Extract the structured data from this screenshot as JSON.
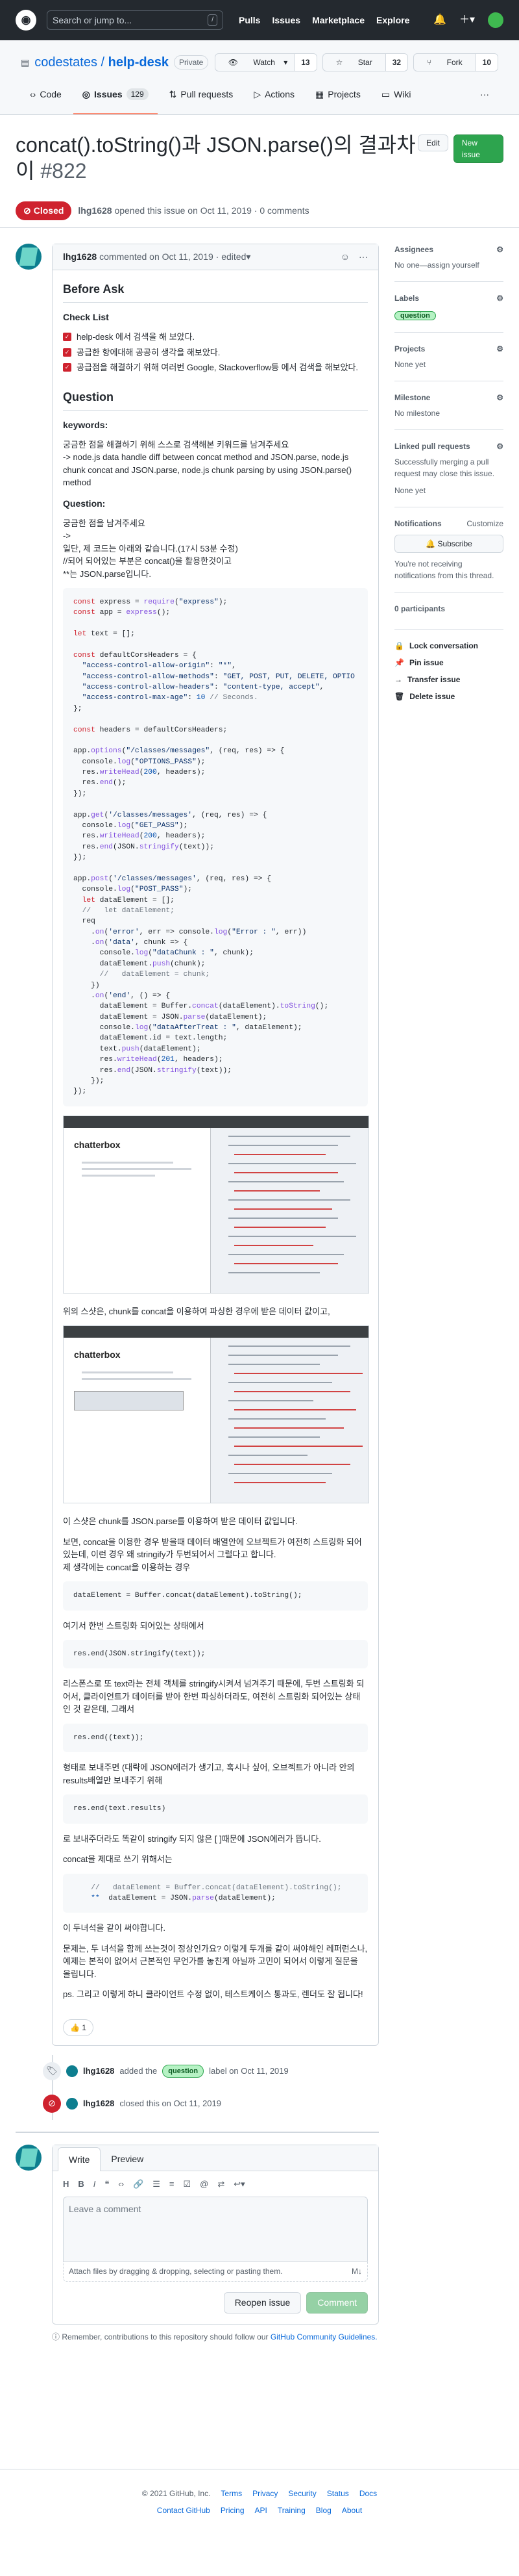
{
  "header": {
    "search_placeholder": "Search or jump to...",
    "search_key": "/",
    "nav": [
      "Pulls",
      "Issues",
      "Marketplace",
      "Explore"
    ]
  },
  "repo": {
    "owner": "codestates",
    "name": "help-desk",
    "visibility": "Private",
    "watch_label": "Watch",
    "watch_count": "13",
    "star_label": "Star",
    "star_count": "32",
    "fork_label": "Fork",
    "fork_count": "10"
  },
  "tabs": [
    {
      "label": "Code"
    },
    {
      "label": "Issues",
      "count": "129"
    },
    {
      "label": "Pull requests"
    },
    {
      "label": "Actions"
    },
    {
      "label": "Projects"
    },
    {
      "label": "Wiki"
    }
  ],
  "issue": {
    "title": "concat().toString()과 JSON.parse()의 결과차이",
    "number": "#822",
    "edit_label": "Edit",
    "new_label": "New issue",
    "state": "Closed",
    "author": "lhg1628",
    "opened_text": "opened this issue on Oct 11, 2019 · 0 comments"
  },
  "comment": {
    "author": "lhg1628",
    "meta": "commented on Oct 11, 2019 · edited",
    "h_before": "Before Ask",
    "h_checklist": "Check List",
    "checks": [
      "help-desk 에서 검색을 해 보았다.",
      "공급한 항에대해 공공히 생각을 해보았다.",
      "공급점을 해결하기 위해 여러번 Google, Stackoverflow등 에서 검색을 해보았다."
    ],
    "h_question": "Question",
    "h_keywords": "keywords:",
    "kw_p": "궁금한 점을 해결하기 위해 스스로 검색해본 키워드를 남겨주세요\n-> node.js data handle diff between concat method and JSON.parse, node.js chunk concat and JSON.parse, node.js chunk parsing by using JSON.parse() method",
    "h_q2": "Question:",
    "q_p": "궁금한 점을 남겨주세요\n->\n일단, 제 코드는 아래와 같습니다.(17시 53분 수정)\n//되어 되어있는 부분은 concat()을 활용한것이고\n**는 JSON.parse입니다.",
    "shot_title": "chatterbox",
    "after1": "위의 스샷은, chunk를 concat을 이용하여 파싱한 경우에 받은 데이터 값이고,",
    "after2": "이 스샷은 chunk를 JSON.parse를 이용하여 받은 데이터 값입니다.",
    "after3": "보면, concat을 이용한 경우 받을때 데이터 배열안에 오브젝트가 여전히 스트링화 되어있는데, 이런 경우 왜 stringify가 두번되어서 그럴다고 합니다.\n제 생각에는 concat을 이용하는 경우",
    "code3": "dataElement = Buffer.concat(dataElement).toString();",
    "after4": "여기서 한번 스트링화 되어있는 상태에서",
    "code4": "res.end(JSON.stringify(text));",
    "after5": "리스폰스로 또 text라는 전체 객체를 stringify시켜서 넘겨주기 때문에, 두번 스트링화 되어서, 클라이언트가 데이터를 받아 한번 파싱하더라도, 여전히 스트링화 되어있는 상태인 것 같은데, 그래서",
    "code5": "res.end((text));",
    "after6": "형태로 보내주면 (대략에 JSON에러가 생기고, 혹시나 싶어, 오브젝트가 아니라 안의 results배열만 보내주기 위해",
    "code6": "res.end(text.results)",
    "after7": "로 보내주더라도 똑같이 stringify 되지 않은 [ ]때문에 JSON에러가 뜹니다.",
    "after8": "concat을 제대로 쓰기 위해서는",
    "after9": "이 두녀석을 같이 써야합니다.",
    "after10": "문제는, 두 녀석을 함께 쓰는것이 정상인가요? 이렇게 두개를 같이 써야해인 레퍼런스나, 예제는 본적이 없어서 근본적인 무언가를 놓친게 아닐까 고민이 되어서 이렇게 질문을 올립니다.",
    "after11": "ps. 그리고 이렇게 하니 클라이언트 수정 없이, 테스트케이스 통과도, 렌더도 잘 됩니다!",
    "react": "👍 1"
  },
  "events": {
    "added_user": "lhg1628",
    "added_text": "added the",
    "label": "question",
    "added_suffix": "label on Oct 11, 2019",
    "closed_user": "lhg1628",
    "closed_text": "closed this on Oct 11, 2019"
  },
  "composer": {
    "tab_write": "Write",
    "tab_preview": "Preview",
    "placeholder": "Leave a comment",
    "attach": "Attach files by dragging & dropping, selecting or pasting them.",
    "reopen": "Reopen issue",
    "submit": "Comment",
    "remember": "Remember, contributions to this repository should follow our",
    "remember_link": "GitHub Community Guidelines."
  },
  "sidebar": {
    "assignees_h": "Assignees",
    "assignees_v": "No one—assign yourself",
    "labels_h": "Labels",
    "labels_v": "question",
    "projects_h": "Projects",
    "projects_v": "None yet",
    "milestone_h": "Milestone",
    "milestone_v": "No milestone",
    "linked_h": "Linked pull requests",
    "linked_v": "Successfully merging a pull request may close this issue.",
    "linked_none": "None yet",
    "notif_h": "Notifications",
    "notif_c": "Customize",
    "subscribe": "Subscribe",
    "notif_v": "You're not receiving notifications from this thread.",
    "participants": "0 participants",
    "actions": [
      "Lock conversation",
      "Pin issue",
      "Transfer issue",
      "Delete issue"
    ]
  },
  "footer": {
    "copy": "© 2021 GitHub, Inc.",
    "row1": [
      "Terms",
      "Privacy",
      "Security",
      "Status",
      "Docs"
    ],
    "row2": [
      "Contact GitHub",
      "Pricing",
      "API",
      "Training",
      "Blog",
      "About"
    ]
  }
}
